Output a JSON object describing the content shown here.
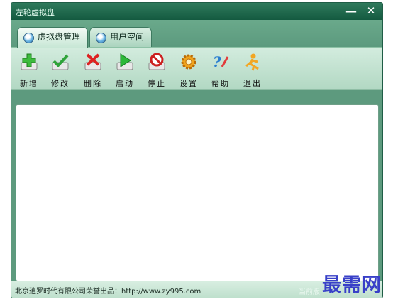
{
  "window": {
    "title": "左轮虚拟盘"
  },
  "controls": {
    "minimize": "—",
    "close": "✕"
  },
  "tabs": [
    {
      "label": "虚拟盘管理",
      "active": true
    },
    {
      "label": "用户空间",
      "active": false
    }
  ],
  "toolbar": [
    {
      "label": "新增",
      "icon": "add-icon"
    },
    {
      "label": "修改",
      "icon": "edit-check-icon"
    },
    {
      "label": "删除",
      "icon": "delete-x-icon"
    },
    {
      "label": "启动",
      "icon": "play-icon"
    },
    {
      "label": "停止",
      "icon": "stop-icon"
    },
    {
      "label": "设置",
      "icon": "gear-icon"
    },
    {
      "label": "帮助",
      "icon": "help-icon"
    },
    {
      "label": "退出",
      "icon": "exit-icon"
    }
  ],
  "status": {
    "left": "北京逍罗时代有限公司荣誉出品：http://www.zy995.com",
    "right": "当前版"
  },
  "watermark": "最需网",
  "colors": {
    "window_bg": "#5d9a7e",
    "titlebar": "#145a40",
    "watermark": "#3840c8"
  }
}
